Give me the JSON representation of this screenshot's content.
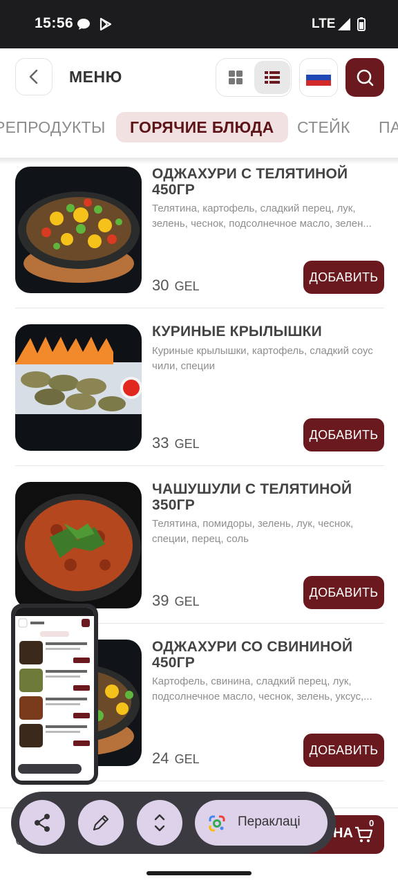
{
  "status_bar": {
    "time": "15:56",
    "network": "LTE"
  },
  "header": {
    "title": "МЕНЮ",
    "brand_color": "#6a1a1e"
  },
  "tabs": [
    {
      "label": "ЗАГОТОВКИ И ПОЛУФАБРИКАТЫ / РЕПРОДУКТЫ",
      "short": "РЕПРОДУКТЫ"
    },
    {
      "label": "ГОРЯЧИЕ БЛЮДА",
      "active": true
    },
    {
      "label": "СТЕЙК"
    },
    {
      "label": "ПА"
    }
  ],
  "items": [
    {
      "name": "ОДЖАХУРИ С ТЕЛЯТИНОЙ 450ГР",
      "description": "Телятина, картофель, сладкий перец, лук, зелень, чеснок, подсолнечное масло, зелен...",
      "price": "30",
      "currency": "GEL",
      "button": "ДОБАВИТЬ"
    },
    {
      "name": "КУРИНЫЕ КРЫЛЫШКИ",
      "description": "Куриные крылышки, картофель, сладкий соус чили, специи",
      "price": "33",
      "currency": "GEL",
      "button": "ДОБАВИТЬ"
    },
    {
      "name": "ЧАШУШУЛИ С ТЕЛЯТИНОЙ 350ГР",
      "description": "Телятина, помидоры, зелень, лук, чеснок, специи, перец, соль",
      "price": "39",
      "currency": "GEL",
      "button": "ДОБАВИТЬ"
    },
    {
      "name": "ОДЖАХУРИ СО СВИНИНОЙ 450ГР",
      "description": "Картофель, свинина, сладкий перец, лук, подсолнечное масло, чеснок, зелень, уксус,...",
      "price": "24",
      "currency": "GEL",
      "button": "ДОБАВИТЬ"
    }
  ],
  "cart": {
    "total_visible": "0",
    "label_visible": "НА",
    "count": "0"
  },
  "overlay": {
    "translate_label": "Пераклацi"
  }
}
